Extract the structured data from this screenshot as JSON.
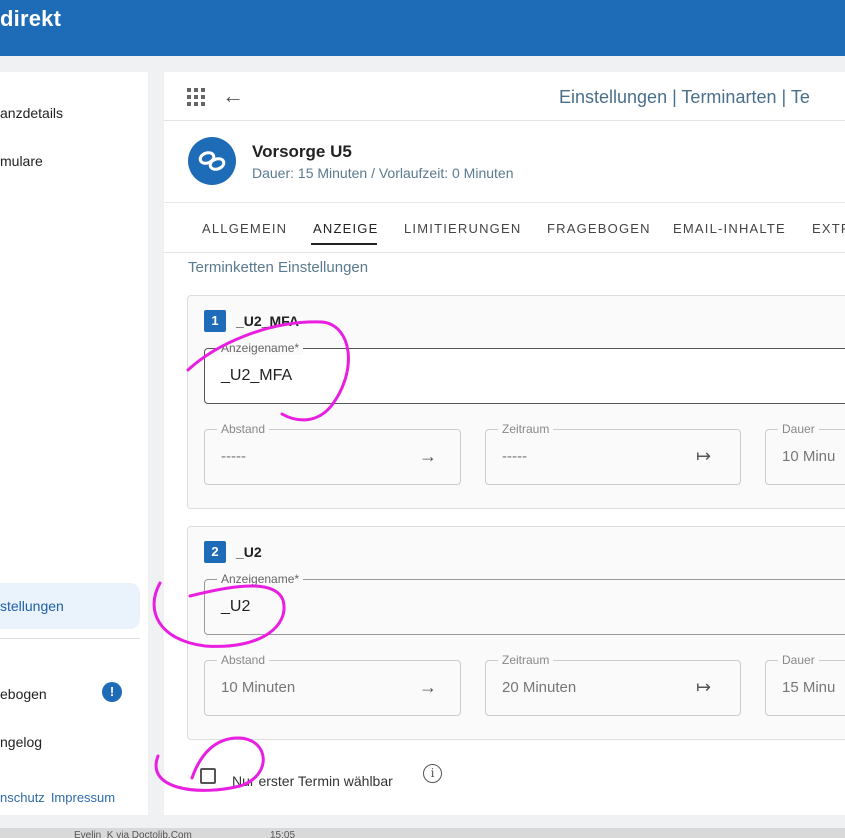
{
  "header": {
    "brand": "direkt",
    "accent": "#1e6bb8"
  },
  "sidebar": {
    "items": [
      {
        "label": "anzdetails"
      },
      {
        "label": "mulare"
      },
      {
        "label": "stellungen"
      },
      {
        "label": "ebogen"
      },
      {
        "label": "ngelog"
      }
    ],
    "warning_badge": "!",
    "footer": {
      "privacy": "nschutz",
      "imprint": "Impressum"
    }
  },
  "main": {
    "breadcrumb": "Einstellungen | Terminarten | Te",
    "appointment": {
      "title": "Vorsorge U5",
      "subtitle": "Dauer: 15 Minuten / Vorlaufzeit: 0 Minuten"
    },
    "tabs": [
      {
        "label": "ALLGEMEIN"
      },
      {
        "label": "ANZEIGE"
      },
      {
        "label": "LIMITIERUNGEN"
      },
      {
        "label": "FRAGEBOGEN"
      },
      {
        "label": "EMAIL-INHALTE"
      },
      {
        "label": "EXTR"
      }
    ],
    "section_title": "Terminketten Einstellungen",
    "chain": [
      {
        "number": "1",
        "name": "_U2_MFA",
        "display_name_label": "Anzeigename*",
        "display_name_value": "_U2_MFA",
        "abstand_label": "Abstand",
        "abstand_value": "-----",
        "zeitraum_label": "Zeitraum",
        "zeitraum_value": "-----",
        "dauer_label": "Dauer",
        "dauer_value": "10 Minu"
      },
      {
        "number": "2",
        "name": "_U2",
        "display_name_label": "Anzeigename*",
        "display_name_value": "_U2",
        "abstand_label": "Abstand",
        "abstand_value": "10 Minuten",
        "zeitraum_label": "Zeitraum",
        "zeitraum_value": "20 Minuten",
        "dauer_label": "Dauer",
        "dauer_value": "15 Minu"
      }
    ],
    "first_only_checkbox": {
      "label": "Nur erster Termin wählbar",
      "checked": false
    }
  },
  "taskbar": {
    "sender": "Evelin_K via Doctolib.Com",
    "time": "15:05"
  },
  "annotation_color": "#e81ee0"
}
